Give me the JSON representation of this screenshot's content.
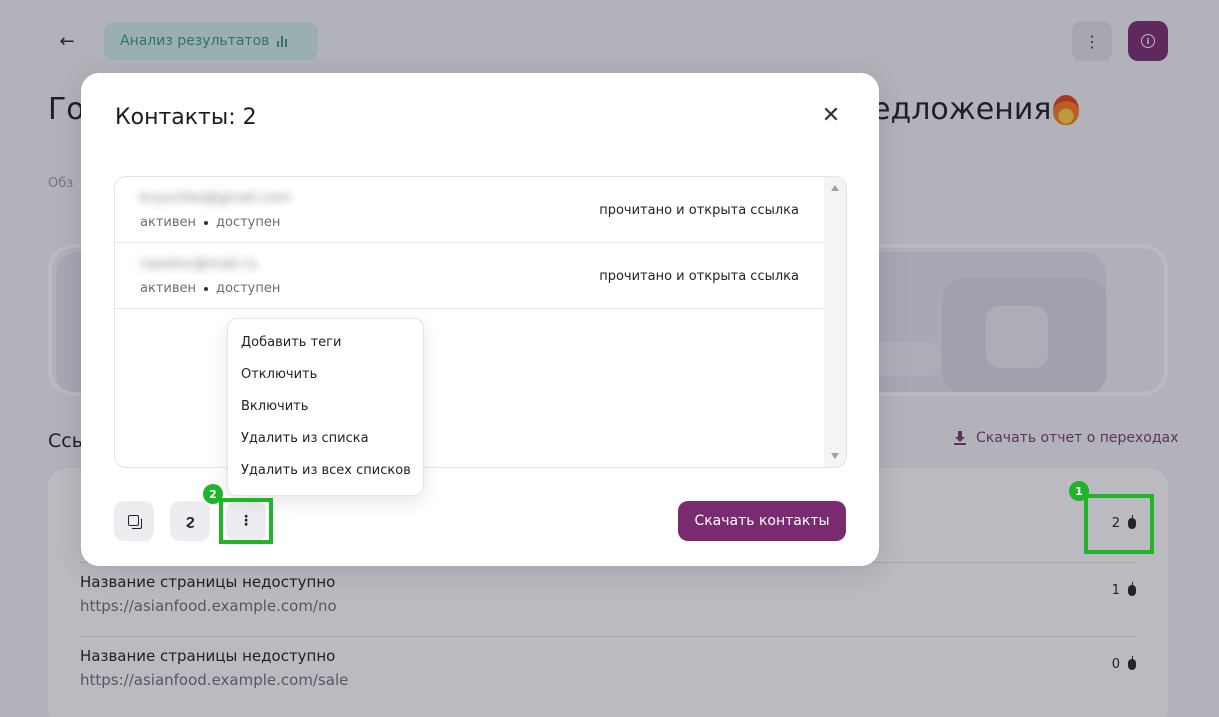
{
  "header": {
    "back_icon": "←",
    "analysis_label": "Анализ результатов",
    "more_icon": "⋮"
  },
  "page": {
    "title_start": "Го",
    "title_end": "едложения",
    "subtitle": "Обз",
    "links_heading": "Ссы",
    "download_report_label": "Скачать отчет о переходах"
  },
  "links": [
    {
      "title": "",
      "url": "",
      "count": "2"
    },
    {
      "title": "Название страницы недоступно",
      "url": "https://asianfood.example.com/no",
      "count": "1"
    },
    {
      "title": "Название страницы недоступно",
      "url": "https://asianfood.example.com/sale",
      "count": "0"
    }
  ],
  "modal": {
    "title": "Контакты: 2",
    "close_icon": "✕",
    "contacts": [
      {
        "email": "kryuchko@gmail.com",
        "state": "активен",
        "availability": "доступен",
        "activity": "прочитано и открыта ссылка"
      },
      {
        "email": "nasolov@mail.ru",
        "state": "активен",
        "availability": "доступен",
        "activity": "прочитано и открыта ссылка"
      }
    ],
    "menu_items": [
      "Добавить теги",
      "Отключить",
      "Включить",
      "Удалить из списка",
      "Удалить из всех списков"
    ],
    "face_icon": "ϩ",
    "more_icon": "⋮",
    "download_button": "Скачать контакты"
  },
  "annotations": {
    "badge_1": "1",
    "badge_2": "2"
  },
  "colors": {
    "accent": "#7a2a6e",
    "analysis_bg": "#d2efe7",
    "highlight": "#1fb42a"
  }
}
